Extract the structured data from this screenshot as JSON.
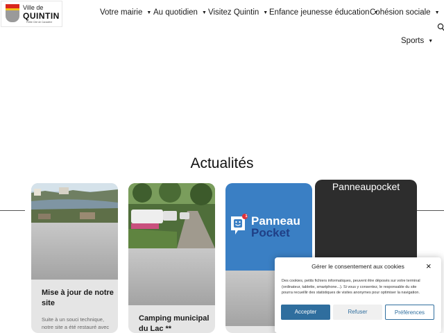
{
  "logo": {
    "line1": "Ville de",
    "line2": "QUINTIN",
    "line3": "Petite Cité de Caractère"
  },
  "nav": {
    "items": [
      {
        "label": "Votre mairie"
      },
      {
        "label": "Au quotidien"
      },
      {
        "label": "Visitez Quintin"
      },
      {
        "label": "Enfance jeunesse éducation"
      },
      {
        "label": "Cohésion sociale"
      },
      {
        "label": "Sports"
      }
    ],
    "chevron": "▼",
    "search_icon": "search-icon"
  },
  "section": {
    "title": "Actualités"
  },
  "cards": [
    {
      "title_line1": "Mise à jour de notre",
      "title_line2": "site",
      "body_line1": "Suite à un souci technique,",
      "body_line2": "notre site a été restauré avec"
    },
    {
      "title_line1": "Camping municipal",
      "title_line2": "du Lac **"
    },
    {
      "brand_line1": "Panneau",
      "brand_line2": "Pocket",
      "badge": "1"
    }
  ],
  "featured": {
    "title": "Panneaupocket"
  },
  "cookie": {
    "title": "Gérer le consentement aux cookies",
    "text_line1": "Des cookies, petits fichiers informatiques, peuvent être déposés sur votre terminal",
    "text_line2": "(ordinateur, tablette, smartphone...). Si vous y consentez, le responsable du site",
    "text_line3": "pourra recueillir des statistiques de visites anonymes pour optimiser la navigation.",
    "accept": "Accepter",
    "refuse": "Refuser",
    "preferences": "Préférences",
    "close": "×"
  },
  "colors": {
    "accent": "#2f6e9e",
    "panneau_blue": "#3a7fc4",
    "dark_card": "#2d2d2d"
  }
}
